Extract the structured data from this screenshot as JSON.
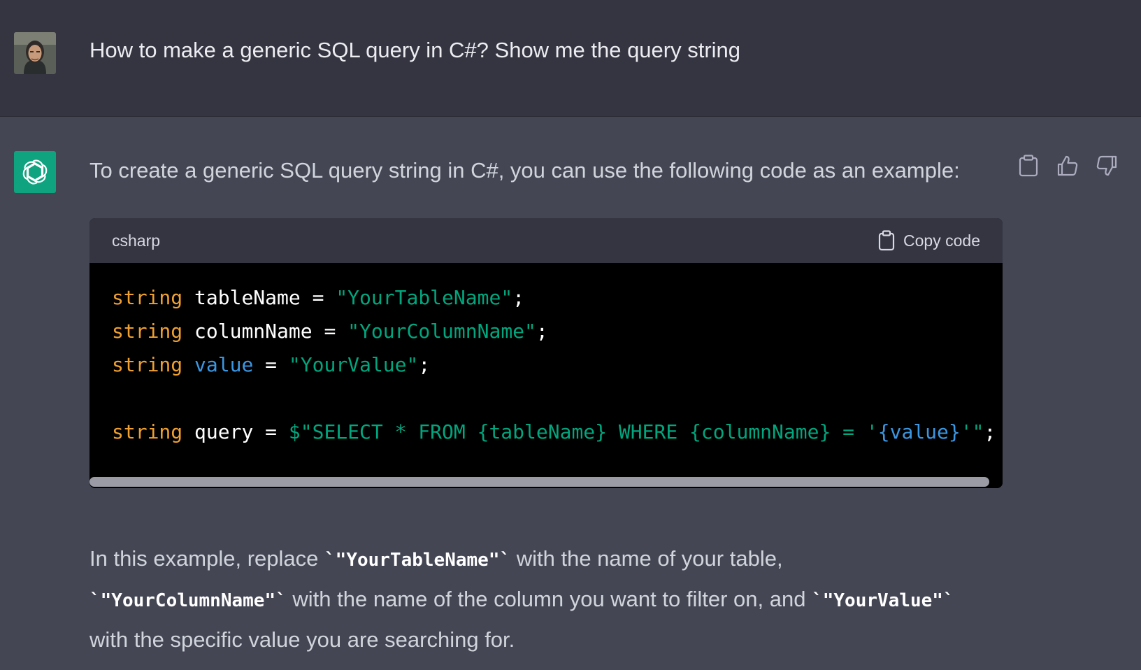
{
  "user_message": {
    "text": "How to make a generic SQL query in C#? Show me the query string"
  },
  "assistant_message": {
    "intro": "To create a generic SQL query string in C#, you can use the following code as an example:",
    "code_block": {
      "language": "csharp",
      "copy_label": "Copy code",
      "lines": [
        [
          {
            "t": "kw",
            "v": "string"
          },
          {
            "t": "plain",
            "v": " tableName = "
          },
          {
            "t": "str",
            "v": "\"YourTableName\""
          },
          {
            "t": "plain",
            "v": ";"
          }
        ],
        [
          {
            "t": "kw",
            "v": "string"
          },
          {
            "t": "plain",
            "v": " columnName = "
          },
          {
            "t": "str",
            "v": "\"YourColumnName\""
          },
          {
            "t": "plain",
            "v": ";"
          }
        ],
        [
          {
            "t": "kw",
            "v": "string"
          },
          {
            "t": "plain",
            "v": " "
          },
          {
            "t": "var",
            "v": "value"
          },
          {
            "t": "plain",
            "v": " = "
          },
          {
            "t": "str",
            "v": "\"YourValue\""
          },
          {
            "t": "plain",
            "v": ";"
          }
        ],
        [],
        [
          {
            "t": "kw",
            "v": "string"
          },
          {
            "t": "plain",
            "v": " query = "
          },
          {
            "t": "str",
            "v": "$\"SELECT * FROM {tableName} WHERE {columnName} = '"
          },
          {
            "t": "var",
            "v": "{value}"
          },
          {
            "t": "str",
            "v": "'\""
          },
          {
            "t": "plain",
            "v": ";"
          }
        ]
      ]
    },
    "explanation": {
      "p1": "In this example, replace ",
      "c1": "`\"YourTableName\"`",
      "p2": " with the name of your table,",
      "c2": "`\"YourColumnName\"`",
      "p3": " with the name of the column you want to filter on, and ",
      "c3": "`\"YourValue\"`",
      "p4": "with the specific value you are searching for."
    }
  },
  "icons": {
    "copy_message": "clipboard-icon",
    "like": "thumbs-up-icon",
    "dislike": "thumbs-down-icon",
    "copy_code": "clipboard-icon",
    "bot_avatar": "openai-logo-icon"
  },
  "colors": {
    "user_bg": "#343541",
    "assistant_bg": "#444654",
    "accent": "#10a37f",
    "keyword": "#f0a02f",
    "string": "#00a67d",
    "variable": "#3b97e3"
  }
}
